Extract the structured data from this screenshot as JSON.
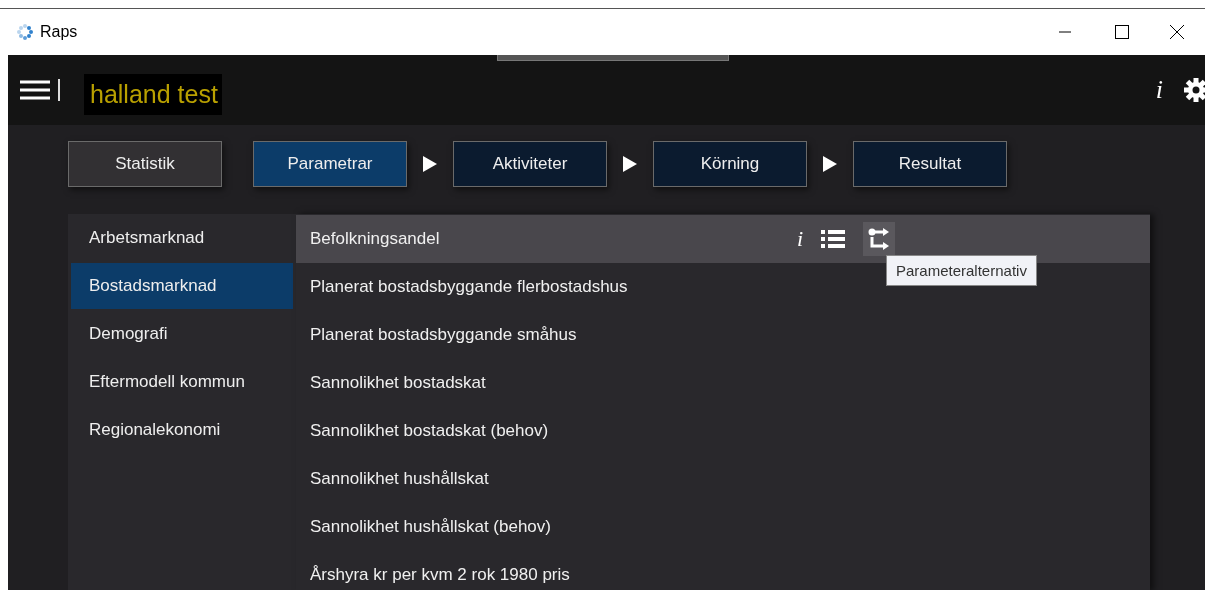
{
  "window": {
    "title": "Raps"
  },
  "header": {
    "project_name": "halland test"
  },
  "steps": [
    {
      "label": "Statistik",
      "kind": "tool",
      "selected": false
    },
    {
      "label": "Parametrar",
      "kind": "step",
      "selected": true
    },
    {
      "label": "Aktiviteter",
      "kind": "step",
      "selected": false
    },
    {
      "label": "Körning",
      "kind": "step",
      "selected": false
    },
    {
      "label": "Resultat",
      "kind": "step",
      "selected": false
    }
  ],
  "categories": [
    {
      "label": "Arbetsmarknad",
      "selected": false
    },
    {
      "label": "Bostadsmarknad",
      "selected": true
    },
    {
      "label": "Demografi",
      "selected": false
    },
    {
      "label": "Eftermodell kommun",
      "selected": false
    },
    {
      "label": "Regionalekonomi",
      "selected": false
    }
  ],
  "parameters": [
    {
      "label": "Befolkningsandel",
      "selected": true
    },
    {
      "label": "Planerat bostadsbyggande flerbostadshus",
      "selected": false
    },
    {
      "label": "Planerat bostadsbyggande småhus",
      "selected": false
    },
    {
      "label": "Sannolikhet bostadskat",
      "selected": false
    },
    {
      "label": "Sannolikhet bostadskat (behov)",
      "selected": false
    },
    {
      "label": "Sannolikhet hushållskat",
      "selected": false
    },
    {
      "label": "Sannolikhet hushållskat (behov)",
      "selected": false
    },
    {
      "label": "Årshyra kr per kvm 2 rok 1980 pris",
      "selected": false
    }
  ],
  "row_actions": {
    "info": "i",
    "tooltip": "Parameteralternativ"
  },
  "header_info": "i"
}
